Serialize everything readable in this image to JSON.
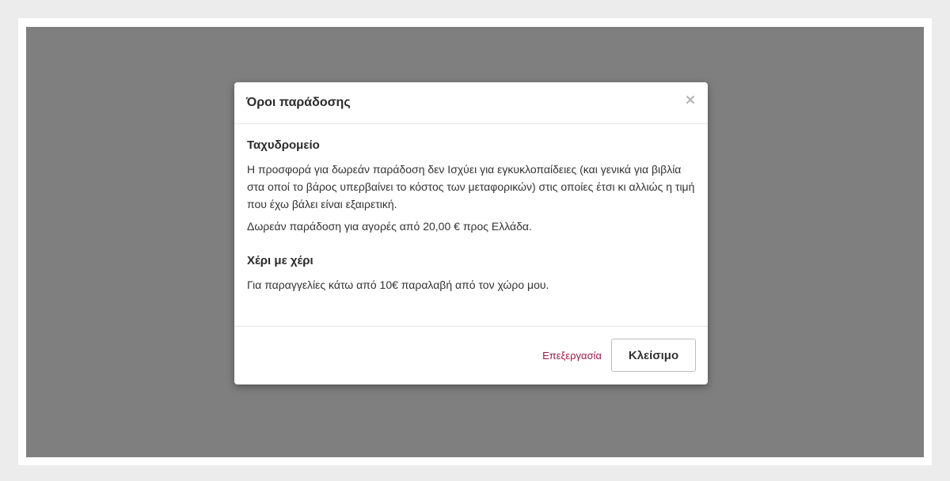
{
  "modal": {
    "title": "Όροι παράδοσης",
    "close_icon": "close-icon",
    "sections": [
      {
        "heading": "Ταχυδρομείο",
        "paragraphs": [
          "Η προσφορά για δωρεάν παράδοση δεν Ισχύει για εγκυκλοπαίδειες (και γενικά για βιβλία στα οποί το βάρος υπερβαίνει το κόστος των μεταφορικών) στις οποίες έτσι κι αλλιώς η τιμή που έχω βάλει είναι εξαιρετική.",
          "Δωρεάν παράδοση για αγορές από 20,00 € προς Ελλάδα."
        ]
      },
      {
        "heading": "Χέρι με χέρι",
        "paragraphs": [
          "Για παραγγελίες κάτω από 10€ παραλαβή από τον χώρο μου."
        ]
      }
    ],
    "footer": {
      "edit_label": "Επεξεργασία",
      "close_label": "Κλείσιμο"
    }
  },
  "colors": {
    "overlay": "#7f7f7f",
    "link": "#9a1b48"
  }
}
